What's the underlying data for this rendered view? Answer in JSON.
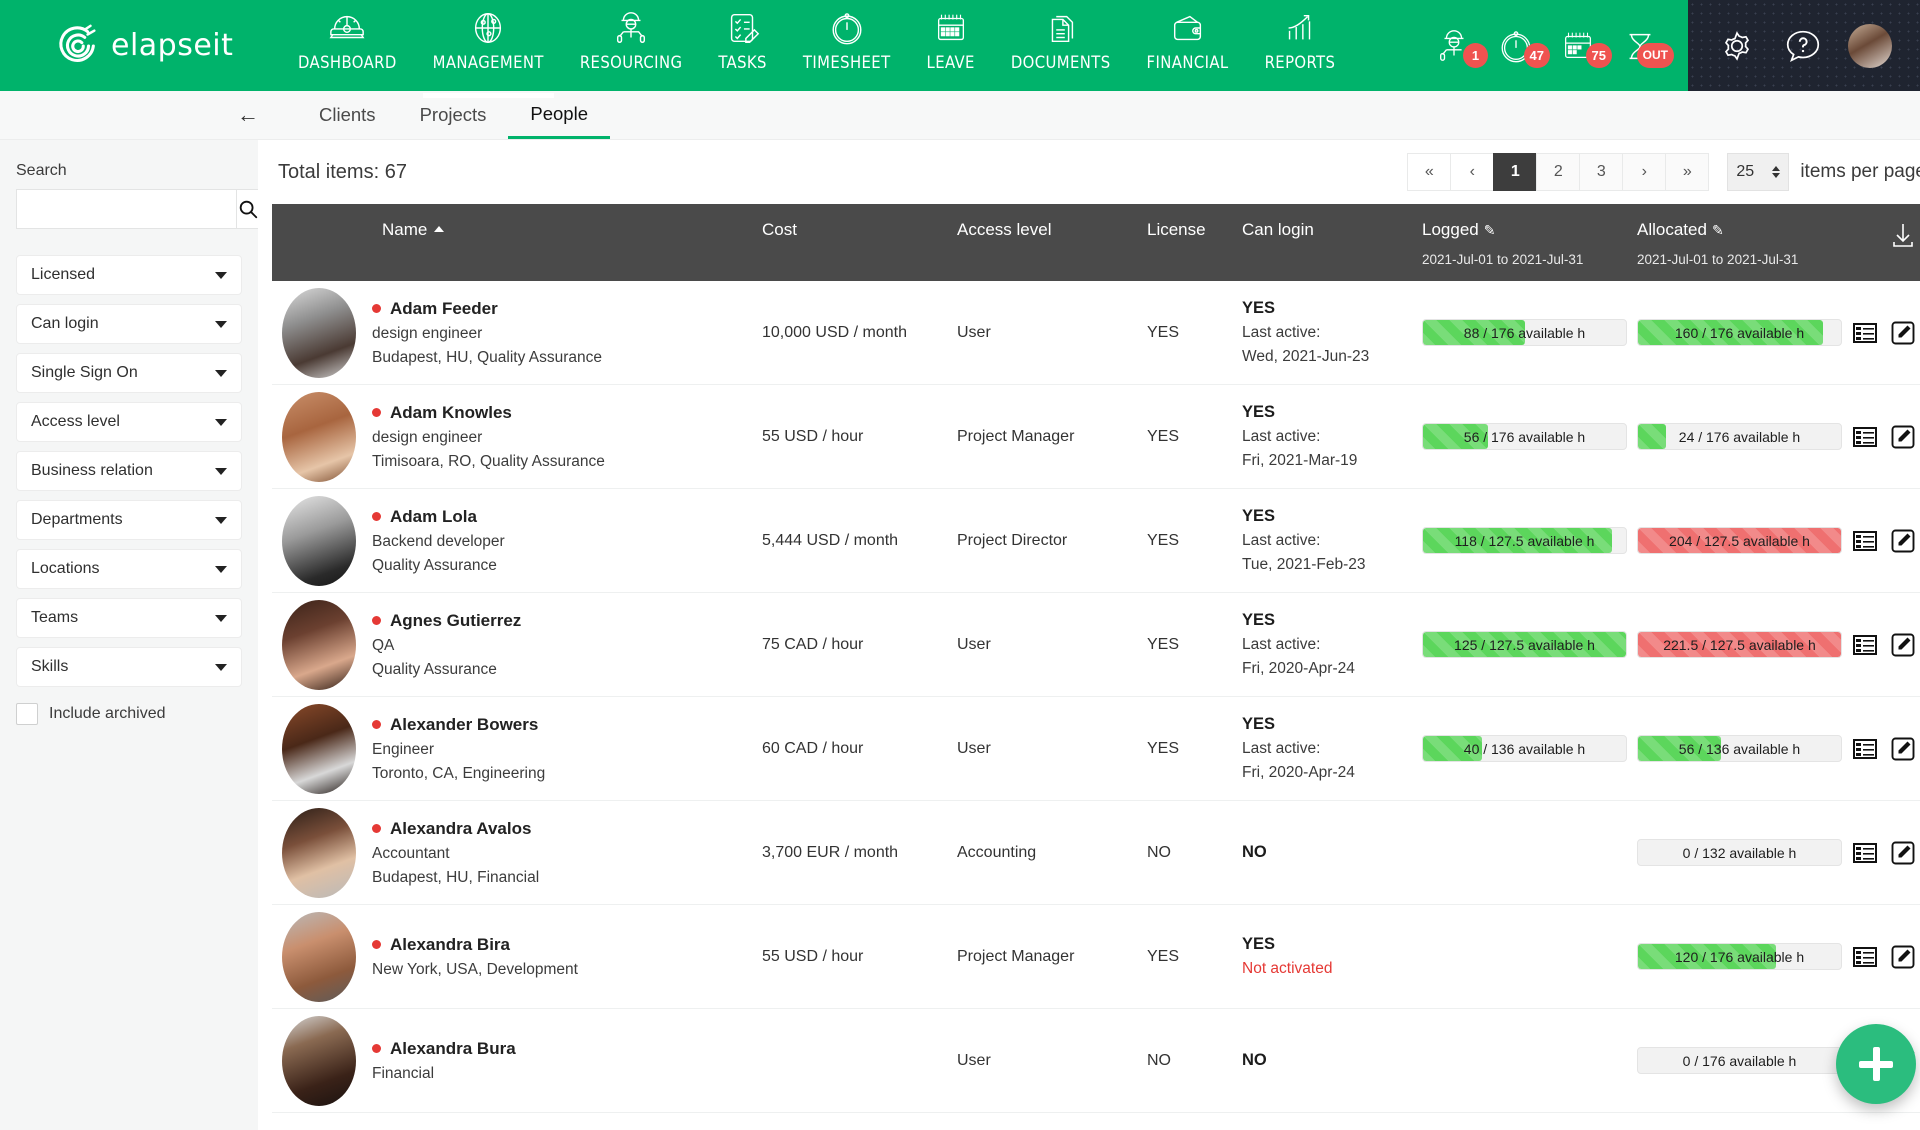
{
  "brand": {
    "name": "elapseit",
    "logo_icon": "elapseit-logo-icon"
  },
  "nav": {
    "items": [
      {
        "label": "DASHBOARD",
        "icon": "gauge-icon",
        "active": false
      },
      {
        "label": "MANAGEMENT",
        "icon": "globe-pin-icon",
        "active": true
      },
      {
        "label": "RESOURCING",
        "icon": "worker-icon",
        "active": false
      },
      {
        "label": "TASKS",
        "icon": "checklist-pencil-icon",
        "active": false
      },
      {
        "label": "TIMESHEET",
        "icon": "stopwatch-icon",
        "active": false
      },
      {
        "label": "LEAVE",
        "icon": "calendar-icon",
        "active": false
      },
      {
        "label": "DOCUMENTS",
        "icon": "documents-icon",
        "active": false
      },
      {
        "label": "FINANCIAL",
        "icon": "wallet-icon",
        "active": false
      },
      {
        "label": "REPORTS",
        "icon": "bar-chart-arrow-icon",
        "active": false
      }
    ]
  },
  "alerts": [
    {
      "icon": "worker-alert-icon",
      "badge": "1"
    },
    {
      "icon": "stopwatch-alert-icon",
      "badge": "47"
    },
    {
      "icon": "calendar-alert-icon",
      "badge": "75"
    },
    {
      "icon": "hourglass-alert-icon",
      "badge": "OUT"
    }
  ],
  "dark_zone": {
    "settings_icon": "gear-icon",
    "help_icon": "question-bubble-icon",
    "avatar": "user-avatar"
  },
  "tabs": {
    "back_icon": "back-arrow-icon",
    "items": [
      {
        "label": "Clients",
        "active": false
      },
      {
        "label": "Projects",
        "active": false
      },
      {
        "label": "People",
        "active": true
      }
    ]
  },
  "sidebar": {
    "search_label": "Search",
    "search_value": "",
    "search_placeholder": "",
    "search_icon": "search-icon",
    "filters": [
      {
        "label": "Licensed"
      },
      {
        "label": "Can login"
      },
      {
        "label": "Single Sign On"
      },
      {
        "label": "Access level"
      },
      {
        "label": "Business relation"
      },
      {
        "label": "Departments"
      },
      {
        "label": "Locations"
      },
      {
        "label": "Teams"
      },
      {
        "label": "Skills"
      }
    ],
    "include_archived": {
      "label": "Include archived",
      "checked": false
    }
  },
  "main": {
    "total_items": "Total items: 67",
    "pagination": {
      "first": "«",
      "prev": "‹",
      "pages": [
        "1",
        "2",
        "3"
      ],
      "current_page": "1",
      "next": "›",
      "last": "»",
      "items_per_page_value": "25",
      "items_per_page_label": "items per page"
    },
    "download_icon": "download-icon",
    "add_button": {
      "icon": "plus-icon",
      "label": ""
    },
    "columns": {
      "name": "Name",
      "cost": "Cost",
      "access_level": "Access level",
      "license": "License",
      "can_login": "Can login",
      "logged": "Logged",
      "logged_range": "2021-Jul-01 to 2021-Jul-31",
      "allocated": "Allocated",
      "allocated_range": "2021-Jul-01 to 2021-Jul-31",
      "sort_icon": "sort-asc-icon",
      "edit_icon": "pencil-icon"
    },
    "rows": [
      {
        "name": "Adam Feeder",
        "role": "design engineer",
        "location": "Budapest, HU, Quality Assurance",
        "cost": "10,000 USD / month",
        "access_level": "User",
        "license": "YES",
        "can_login": "YES",
        "last_active_label": "Last active:",
        "last_active": "Wed, 2021-Jun-23",
        "not_activated": "",
        "logged": {
          "text": "88 / 176 available h",
          "value": 88,
          "max": 176,
          "pct": 50,
          "state": "green",
          "show": true
        },
        "allocated": {
          "text": "160 / 176 available h",
          "value": 160,
          "max": 176,
          "pct": 91,
          "state": "green",
          "show": true
        },
        "avatar_gradient": "linear-gradient(160deg,#dcdcdc 0%,#8e8e8e 35%,#4a3a33 70%,#d6d6d6 100%)"
      },
      {
        "name": "Adam Knowles",
        "role": "design engineer",
        "location": "Timisoara, RO, Quality Assurance",
        "cost": "55 USD / hour",
        "access_level": "Project Manager",
        "license": "YES",
        "can_login": "YES",
        "last_active_label": "Last active:",
        "last_active": "Fri, 2021-Mar-19",
        "not_activated": "",
        "logged": {
          "text": "56 / 176 available h",
          "value": 56,
          "max": 176,
          "pct": 32,
          "state": "green",
          "show": true
        },
        "allocated": {
          "text": "24 / 176 available h",
          "value": 24,
          "max": 176,
          "pct": 14,
          "state": "green",
          "show": true
        },
        "avatar_gradient": "linear-gradient(160deg,#c98f6a 0%,#a8653f 40%,#e6c5a8 75%,#7a4a2c 100%)"
      },
      {
        "name": "Adam Lola",
        "role": "Backend developer",
        "location": "Quality Assurance",
        "cost": "5,444 USD / month",
        "access_level": "Project Director",
        "license": "YES",
        "can_login": "YES",
        "last_active_label": "Last active:",
        "last_active": "Tue, 2021-Feb-23",
        "not_activated": "",
        "logged": {
          "text": "118 / 127.5 available h",
          "value": 118,
          "max": 127.5,
          "pct": 93,
          "state": "green",
          "show": true
        },
        "allocated": {
          "text": "204 / 127.5 available h",
          "value": 204,
          "max": 127.5,
          "pct": 100,
          "state": "red",
          "show": true
        },
        "avatar_gradient": "linear-gradient(160deg,#e8e8e8 0%,#9a9a9a 40%,#2a2a2a 80%,#151515 100%)"
      },
      {
        "name": "Agnes Gutierrez",
        "role": "QA",
        "location": "Quality Assurance",
        "cost": "75 CAD / hour",
        "access_level": "User",
        "license": "YES",
        "can_login": "YES",
        "last_active_label": "Last active:",
        "last_active": "Fri, 2020-Apr-24",
        "not_activated": "",
        "logged": {
          "text": "125 / 127.5 available h",
          "value": 125,
          "max": 127.5,
          "pct": 100,
          "state": "green",
          "show": true
        },
        "allocated": {
          "text": "221.5 / 127.5 available h",
          "value": 221.5,
          "max": 127.5,
          "pct": 100,
          "state": "red",
          "show": true
        },
        "avatar_gradient": "linear-gradient(160deg,#3a2218 0%,#6b4030 35%,#d9a88c 70%,#2c1a12 100%)"
      },
      {
        "name": "Alexander Bowers",
        "role": "Engineer",
        "location": "Toronto, CA, Engineering",
        "cost": "60 CAD / hour",
        "access_level": "User",
        "license": "YES",
        "can_login": "YES",
        "last_active_label": "Last active:",
        "last_active": "Fri, 2020-Apr-24",
        "not_activated": "",
        "logged": {
          "text": "40 / 136 available h",
          "value": 40,
          "max": 136,
          "pct": 29,
          "state": "green",
          "show": true
        },
        "allocated": {
          "text": "56 / 136 available h",
          "value": 56,
          "max": 136,
          "pct": 41,
          "state": "green",
          "show": true
        },
        "avatar_gradient": "linear-gradient(160deg,#8a4a2a 0%,#4a2818 40%,#d8d8d8 72%,#1c1410 100%)"
      },
      {
        "name": "Alexandra Avalos",
        "role": "Accountant",
        "location": "Budapest, HU, Financial",
        "cost": "3,700 EUR / month",
        "access_level": "Accounting",
        "license": "NO",
        "can_login": "NO",
        "last_active_label": "",
        "last_active": "",
        "not_activated": "",
        "logged": {
          "text": "",
          "value": 0,
          "max": 0,
          "pct": 0,
          "state": "none",
          "show": false
        },
        "allocated": {
          "text": "0 / 132 available h",
          "value": 0,
          "max": 132,
          "pct": 0,
          "state": "green",
          "show": true
        },
        "avatar_gradient": "linear-gradient(160deg,#2a1d16 0%,#7a4f3a 35%,#e0c0a4 65%,#b9b9b9 100%)"
      },
      {
        "name": "Alexandra Bira",
        "role": "",
        "location": "New York, USA, Development",
        "cost": "55 USD / hour",
        "access_level": "Project Manager",
        "license": "YES",
        "can_login": "YES",
        "last_active_label": "",
        "last_active": "",
        "not_activated": "Not activated",
        "logged": {
          "text": "",
          "value": 0,
          "max": 0,
          "pct": 0,
          "state": "none",
          "show": false
        },
        "allocated": {
          "text": "120 / 176 available h",
          "value": 120,
          "max": 176,
          "pct": 68,
          "state": "green",
          "show": true
        },
        "avatar_gradient": "linear-gradient(160deg,#b9b9b9 0%,#c98f6e 35%,#8d5a3c 70%,#5c5c5c 100%)"
      },
      {
        "name": "Alexandra Bura",
        "role": "",
        "location": "Financial",
        "cost": "",
        "access_level": "User",
        "license": "NO",
        "can_login": "NO",
        "last_active_label": "",
        "last_active": "",
        "not_activated": "",
        "logged": {
          "text": "",
          "value": 0,
          "max": 0,
          "pct": 0,
          "state": "none",
          "show": false
        },
        "allocated": {
          "text": "0 / 176 available h",
          "value": 0,
          "max": 176,
          "pct": 0,
          "state": "green",
          "show": true
        },
        "avatar_gradient": "linear-gradient(160deg,#d8d8d8 0%,#8a6a52 30%,#3a2218 70%,#1a1210 100%)"
      }
    ],
    "row_actions": {
      "details_icon": "list-details-icon",
      "edit_icon": "edit-pencil-icon"
    }
  }
}
